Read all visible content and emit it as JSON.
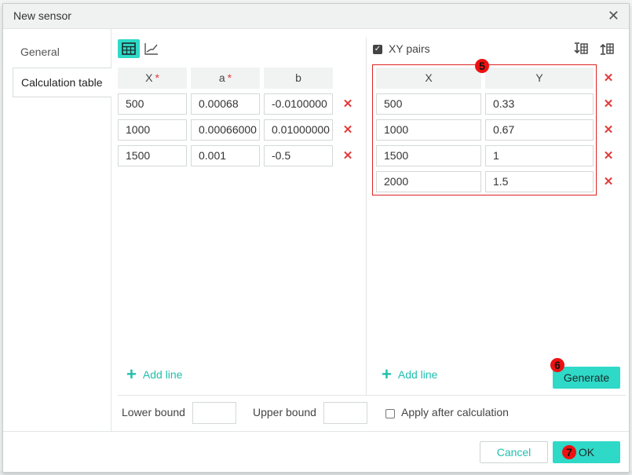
{
  "dialog": {
    "title": "New sensor",
    "close_glyph": "✕"
  },
  "nav": {
    "items": [
      {
        "label": "General"
      },
      {
        "label": "Calculation table"
      }
    ]
  },
  "left_table": {
    "view_icons": [
      "table-icon",
      "line-chart-icon"
    ],
    "headers": [
      {
        "label": "X",
        "required": true
      },
      {
        "label": "a",
        "required": true
      },
      {
        "label": "b",
        "required": false
      }
    ],
    "rows": [
      [
        "500",
        "0.00068",
        "-0.0100000"
      ],
      [
        "1000",
        "0.00066000",
        "0.01000000"
      ],
      [
        "1500",
        "0.001",
        "-0.5"
      ]
    ],
    "add_line_label": "Add line",
    "required_mark": "*"
  },
  "right_table": {
    "xy_pairs_label": "XY pairs",
    "xy_pairs_checked": true,
    "toolbar_icons": [
      "import-table-icon",
      "export-table-icon"
    ],
    "headers": [
      "X",
      "Y"
    ],
    "rows": [
      [
        "500",
        "0.33"
      ],
      [
        "1000",
        "0.67"
      ],
      [
        "1500",
        "1"
      ],
      [
        "2000",
        "1.5"
      ]
    ],
    "add_line_label": "Add line",
    "generate_label": "Generate"
  },
  "bounds": {
    "lower_label": "Lower bound",
    "lower_value": "",
    "upper_label": "Upper bound",
    "upper_value": "",
    "apply_label": "Apply after calculation",
    "apply_checked": false
  },
  "footer": {
    "cancel_label": "Cancel",
    "ok_label": "OK"
  },
  "annotations": {
    "marker_5": "5",
    "marker_6": "6",
    "marker_7": "7"
  },
  "colors": {
    "accent": "#2fd9c7",
    "accent_text": "#1fbfae",
    "delete": "#e23b3b",
    "annotation": "#dd1111"
  }
}
